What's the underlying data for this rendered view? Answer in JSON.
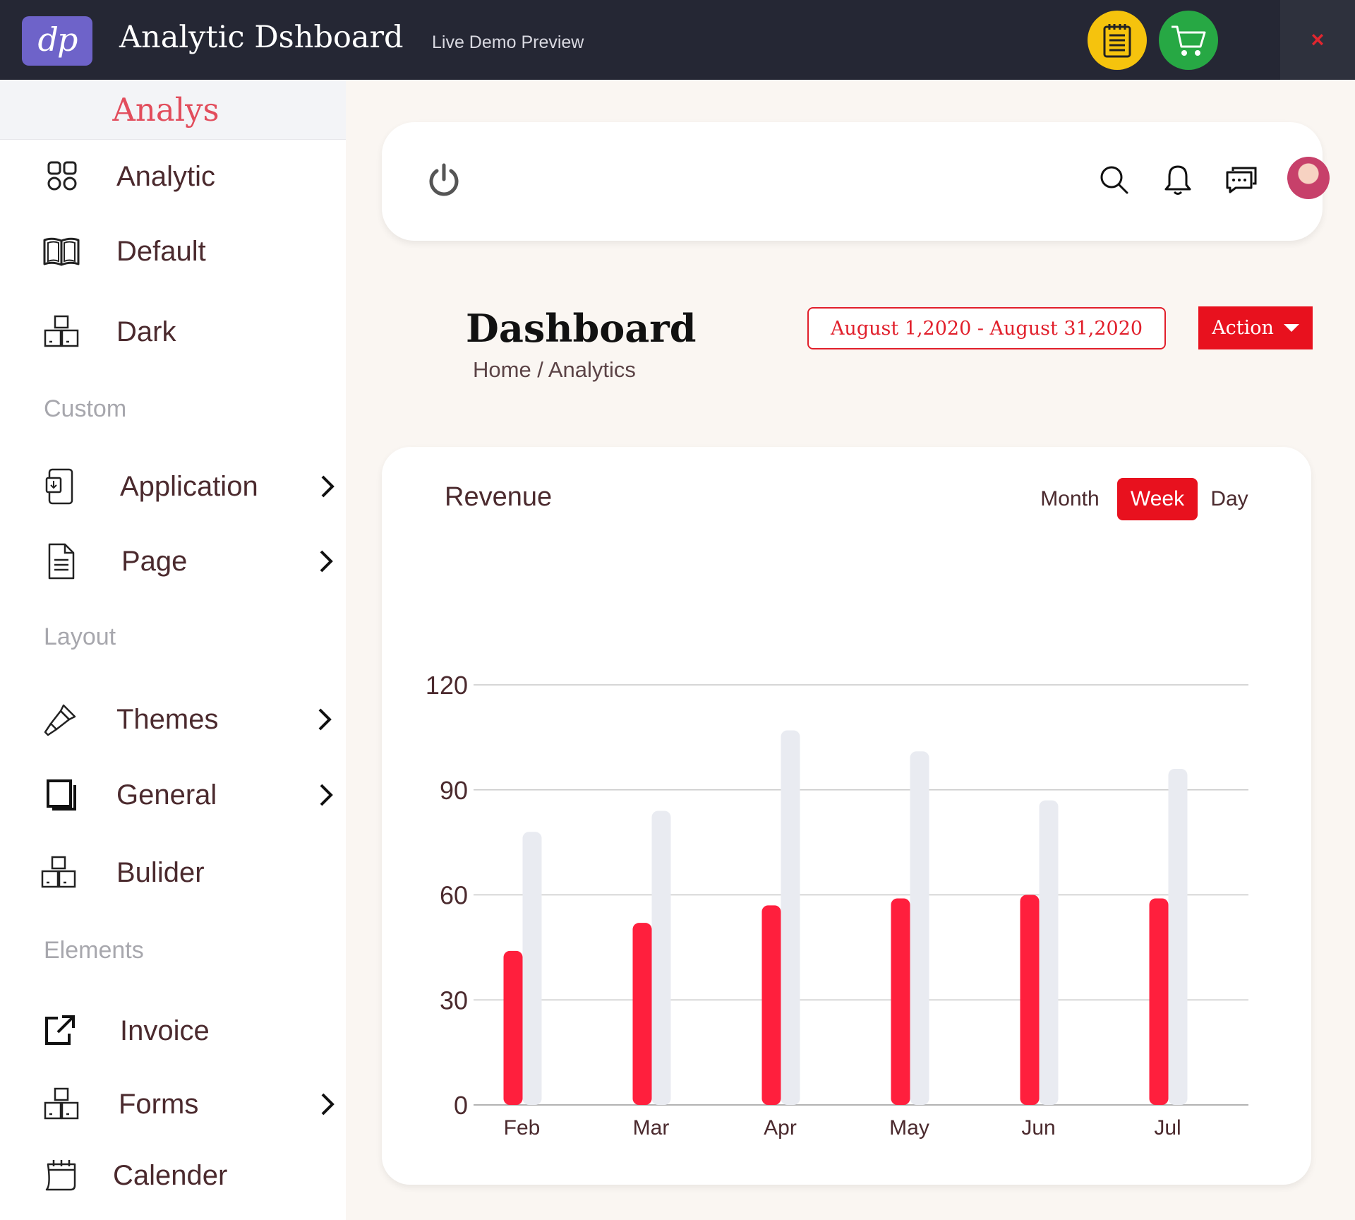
{
  "header": {
    "logo_text": "dp",
    "title": "Analytic Dshboard",
    "subtitle": "Live Demo Preview",
    "buttons": [
      "notepad-icon",
      "cart-icon"
    ],
    "close_label": "×"
  },
  "sidebar": {
    "title": "Analys",
    "items": [
      {
        "label": "Analytic",
        "icon": "grid-icon"
      },
      {
        "label": "Default",
        "icon": "book-icon"
      },
      {
        "label": "Dark",
        "icon": "boxes-icon"
      },
      {
        "label": "Application",
        "icon": "tablet-icon"
      },
      {
        "label": "Page",
        "icon": "document-icon"
      },
      {
        "label": "Themes",
        "icon": "brush-icon"
      },
      {
        "label": "General",
        "icon": "stack-icon"
      },
      {
        "label": "Bulider",
        "icon": "boxes-icon"
      },
      {
        "label": "Invoice",
        "icon": "external-link-icon"
      },
      {
        "label": "Forms",
        "icon": "boxes-icon"
      },
      {
        "label": "Calender",
        "icon": "calendar-icon"
      }
    ],
    "sections": [
      "Custom",
      "Layout",
      "Elements"
    ]
  },
  "topbar": {
    "icons": [
      "power-icon",
      "search-icon",
      "bell-icon",
      "chat-icon",
      "avatar"
    ]
  },
  "page": {
    "title": "Dashboard",
    "breadcrumb": "Home / Analytics",
    "date_range": "August 1,2020 - August 31,2020",
    "action_label": "Action"
  },
  "revenue": {
    "title": "Revenue",
    "periods": [
      "Month",
      "Week",
      "Day"
    ],
    "active_period": "Week"
  },
  "colors": {
    "accent": "#e8111e",
    "bar_primary": "#ff1f3d",
    "bar_secondary": "#e9ebf1",
    "header_bg": "#252734"
  },
  "chart_data": {
    "type": "bar",
    "categories": [
      "Feb",
      "Mar",
      "Apr",
      "May",
      "Jun",
      "Jul"
    ],
    "series": [
      {
        "values": [
          44,
          52,
          57,
          59,
          60,
          59
        ],
        "color": "#ff1f3d"
      },
      {
        "values": [
          78,
          84,
          107,
          101,
          87,
          96
        ],
        "color": "#e9ebf1"
      }
    ],
    "yticks": [
      0,
      30,
      60,
      90,
      120
    ],
    "ylim": [
      0,
      120
    ],
    "title": "",
    "xlabel": "",
    "ylabel": "",
    "grid": true
  }
}
